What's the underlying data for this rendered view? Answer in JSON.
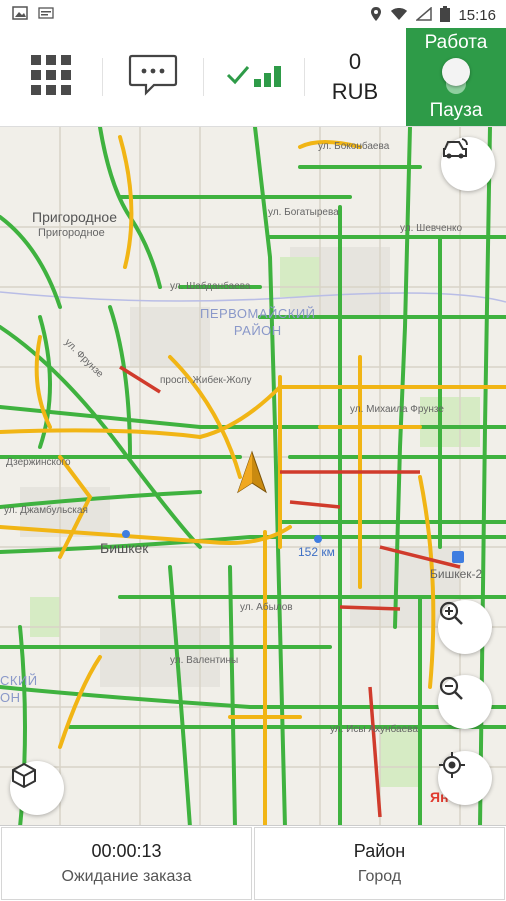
{
  "statusbar": {
    "time": "15:16",
    "icons": [
      "image-icon",
      "notification-icon",
      "location-icon",
      "wifi-icon",
      "signal-icon",
      "battery-icon"
    ]
  },
  "toolbar": {
    "menu_icon": "grid-menu-icon",
    "chat_icon": "chat-icon",
    "connection_icon": "connection-status-icon",
    "balance_amount": "0",
    "balance_currency": "RUB",
    "work_label": "Работа",
    "pause_label": "Пауза",
    "accent_color": "#2e9b48"
  },
  "map": {
    "places": {
      "prigorodnoe": "Пригородное",
      "prigorodnoe_small": "Пригородное",
      "district_1": "ПЕРВОМАЙСКИЙ",
      "district_2": "РАЙОН",
      "district_left_1": "СКИЙ",
      "district_left_2": "ОН",
      "bishkek": "Бишкек",
      "bishkek2": "Бишкек-2",
      "km": "152 км",
      "yandex": "Ян"
    },
    "streets": [
      "ул. Боконбаева",
      "ул. Богатырева",
      "ул. Шабданбаева",
      "ул. Шевченко",
      "ул. Фрунзе",
      "просп. Жибек-Жолу",
      "ул. Михаила Фрунзе",
      "Дзержинского",
      "ул. Джамбульская",
      "ул. Абылов",
      "ул. Исы Ахунбаева",
      "ул. Валентины"
    ],
    "controls": [
      "traffic-car-icon",
      "zoom-in-icon",
      "zoom-out-icon",
      "3d-cube-icon",
      "my-location-icon"
    ]
  },
  "bottom": {
    "timer": "00:00:13",
    "status": "Ожидание заказа",
    "area_title": "Район",
    "area_value": "Город"
  }
}
